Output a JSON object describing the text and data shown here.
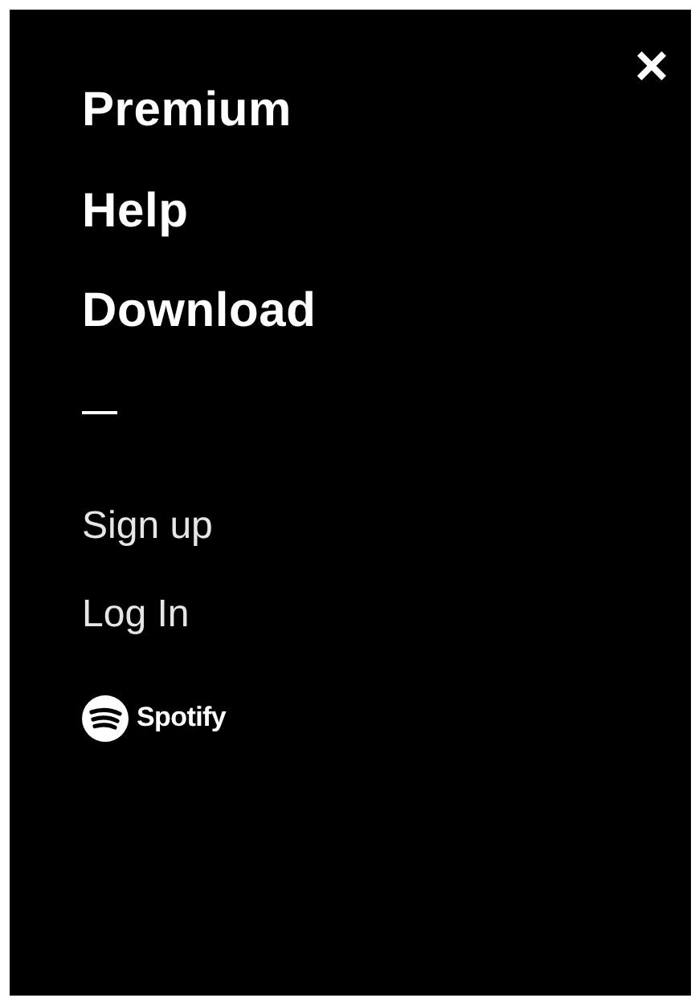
{
  "close_button": {
    "label": "×"
  },
  "primary_links": [
    {
      "label": "Premium"
    },
    {
      "label": "Help"
    },
    {
      "label": "Download"
    }
  ],
  "secondary_links": [
    {
      "label": "Sign up"
    },
    {
      "label": "Log In"
    }
  ],
  "logo": {
    "text": "Spotify"
  }
}
